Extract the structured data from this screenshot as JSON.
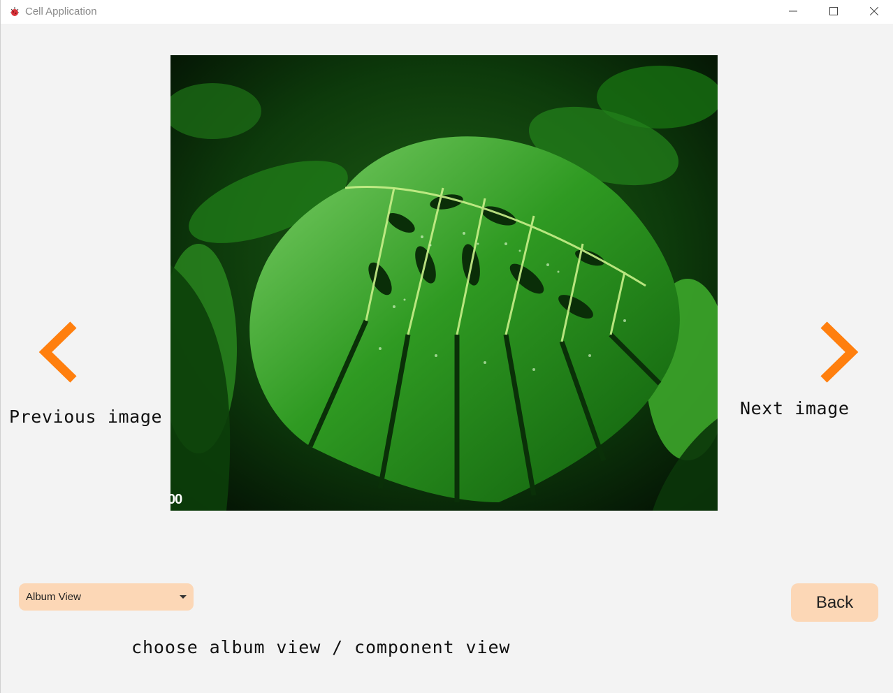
{
  "window": {
    "title": "Cell Application",
    "icon": "cell-app-icon",
    "controls": {
      "minimize": "minimize-icon",
      "maximize": "maximize-icon",
      "close": "close-icon"
    }
  },
  "viewer": {
    "image_description_icon": "monstera-leaf-photo",
    "image_corner_text": "00",
    "prev_label": "Previous image",
    "next_label": "Next image",
    "prev_icon": "chevron-left-icon",
    "next_icon": "chevron-right-icon",
    "arrow_color": "#ff7f0e"
  },
  "view_selector": {
    "selected": "Album View",
    "hint": "choose album view / component view",
    "accent": "#fcd7b6"
  },
  "actions": {
    "back_label": "Back"
  }
}
